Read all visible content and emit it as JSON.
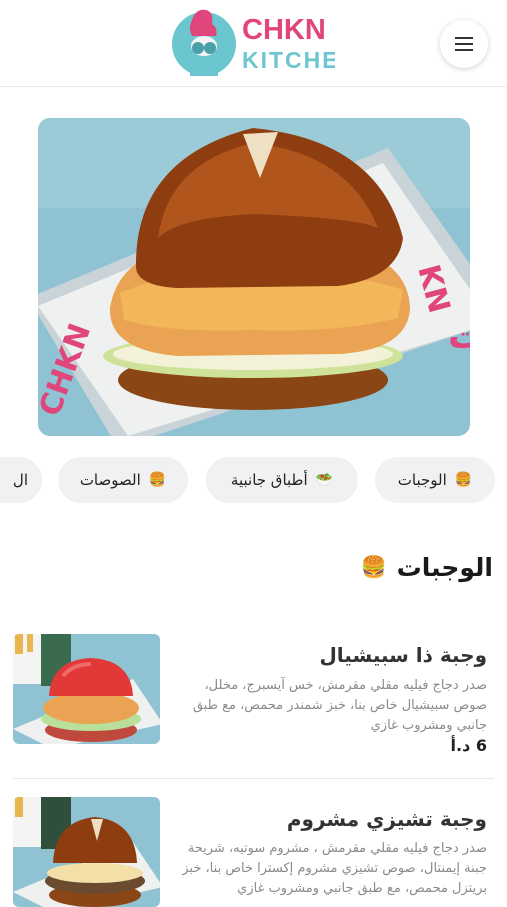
{
  "header": {
    "logo_word1": "CHKN",
    "logo_word2": "KITCHEN",
    "menu_icon": "hamburger-icon"
  },
  "hero": {
    "alt": "Pretzel bun fried chicken burger"
  },
  "categories": [
    {
      "label": "الوجبات",
      "emoji": "🍔"
    },
    {
      "label": "أطباق جانبية",
      "emoji": "🥗"
    },
    {
      "label": "الصوصات",
      "emoji": "🍔"
    },
    {
      "label": "ال",
      "emoji": ""
    }
  ],
  "section": {
    "title": "الوجبات",
    "emoji": "🍔"
  },
  "items": [
    {
      "title": "وجبة ذا سبيشيال",
      "desc": "صدر دجاج فيليه مقلي مقرمش، خس آيسبرج، مخلل، صوص سبيشيال خاص بنا، خبز شمندر محمص، مع طبق جانبي ومشروب غازي",
      "price": "6 د.أ"
    },
    {
      "title": "وجبة تشيزي مشروم",
      "desc": "صدر دجاج فيليه مقلي مقرمش ، مشروم سوتيه، شريحة جبنة إيمنتال، صوص تشيزي مشروم إكسترا خاص بنا، خبز بريتزل محمص، مع طبق جانبي ومشروب غازي",
      "price": ""
    }
  ],
  "colors": {
    "brand_pink": "#e0457b",
    "brand_teal": "#6cc6cf",
    "tray_blue": "#7fb7c9"
  }
}
